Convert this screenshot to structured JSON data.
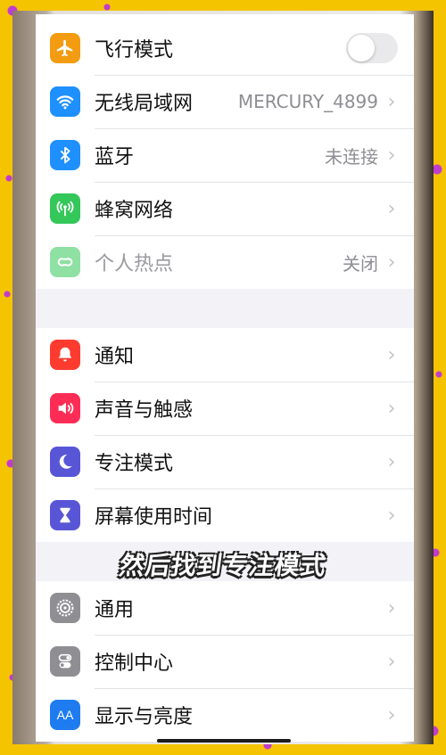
{
  "overlay_caption": "然后找到专注模式",
  "groups": [
    {
      "items": [
        {
          "label": "飞行模式",
          "icon": "airplane-icon",
          "color": "#f39c12",
          "toggle": false
        },
        {
          "label": "无线局域网",
          "icon": "wifi-icon",
          "color": "#1e90ff",
          "value": "MERCURY_4899"
        },
        {
          "label": "蓝牙",
          "icon": "bluetooth-icon",
          "color": "#1e90ff",
          "value": "未连接"
        },
        {
          "label": "蜂窝网络",
          "icon": "cellular-icon",
          "color": "#34c759",
          "value": ""
        },
        {
          "label": "个人热点",
          "icon": "hotspot-icon",
          "color": "#34c759",
          "value": "关闭",
          "disabled": true
        }
      ]
    },
    {
      "items": [
        {
          "label": "通知",
          "icon": "notification-bell-icon",
          "color": "#ff3b30"
        },
        {
          "label": "声音与触感",
          "icon": "speaker-icon",
          "color": "#ff2d55"
        },
        {
          "label": "专注模式",
          "icon": "moon-icon",
          "color": "#5856d6"
        },
        {
          "label": "屏幕使用时间",
          "icon": "hourglass-icon",
          "color": "#5856d6"
        }
      ]
    },
    {
      "items": [
        {
          "label": "通用",
          "icon": "gear-icon",
          "color": "#8e8e93"
        },
        {
          "label": "控制中心",
          "icon": "toggles-icon",
          "color": "#8e8e93"
        },
        {
          "label": "显示与亮度",
          "icon": "text-size-icon",
          "color": "#1e7cf0",
          "icon_text": "AA"
        }
      ]
    }
  ],
  "chevron_glyph": "›"
}
